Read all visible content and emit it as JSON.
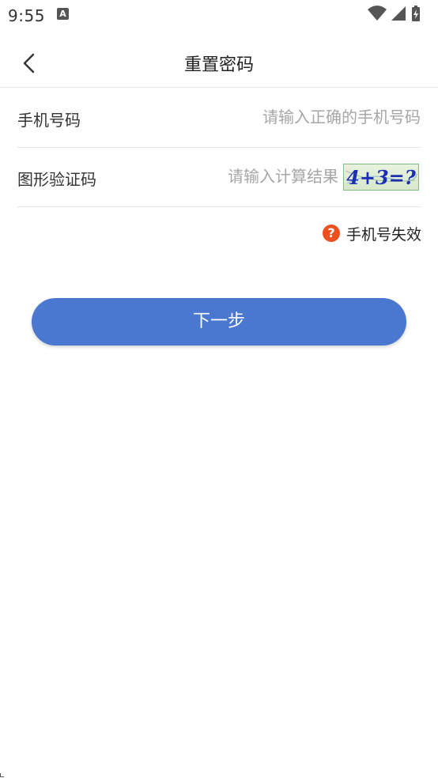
{
  "status_bar": {
    "time": "9:55",
    "app_icon_letter": "A",
    "icons": [
      "app-notification-icon",
      "wifi-icon",
      "cell-signal-icon",
      "battery-charging-icon"
    ]
  },
  "header": {
    "title": "重置密码",
    "back_icon": "chevron-left-icon"
  },
  "form": {
    "phone": {
      "label": "手机号码",
      "placeholder": "请输入正确的手机号码",
      "value": ""
    },
    "captcha": {
      "label": "图形验证码",
      "placeholder": "请输入计算结果",
      "value": "",
      "image_text": "4+3=?"
    }
  },
  "hint": {
    "icon": "question-circle-icon",
    "text": "手机号失效"
  },
  "next_button": {
    "label": "下一步"
  },
  "colors": {
    "primary": "#4a78d1",
    "warning": "#ee4f1e",
    "divider": "#e6e6e6",
    "placeholder": "#a6a6a6"
  }
}
